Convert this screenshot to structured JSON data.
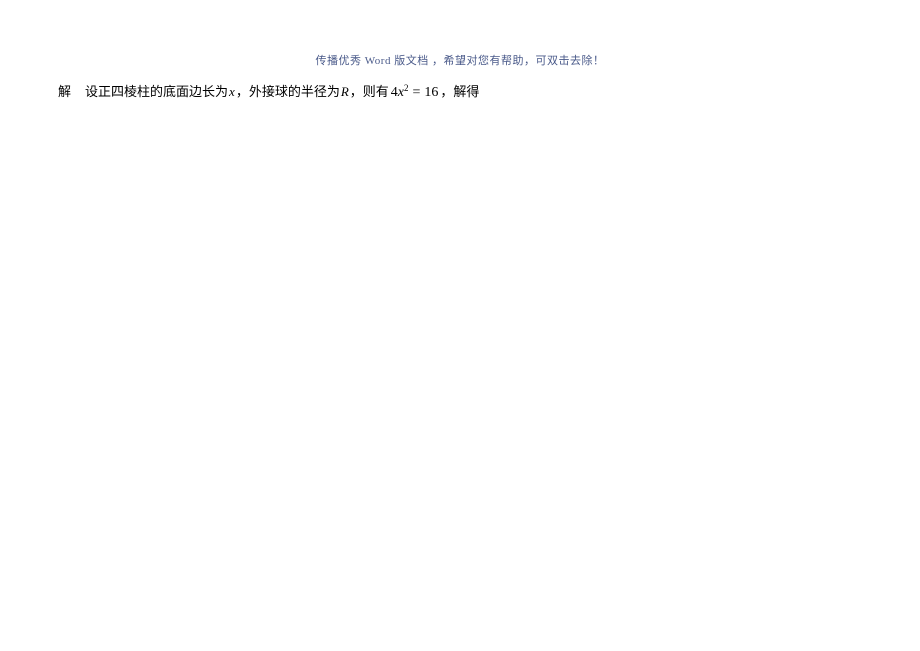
{
  "header": {
    "note": "传播优秀 Word 版文档 ，希望对您有帮助，可双击去除！"
  },
  "content": {
    "answer_label": "解",
    "part1": "设正四棱柱的底面边长为",
    "var1": "x",
    "part2": "，外接球的半径为",
    "var2": "R",
    "part3": "，则有",
    "expr": {
      "coef": "4",
      "var": "x",
      "sup": "2",
      "eq": "=",
      "num": "16"
    },
    "part4": "，解得"
  }
}
